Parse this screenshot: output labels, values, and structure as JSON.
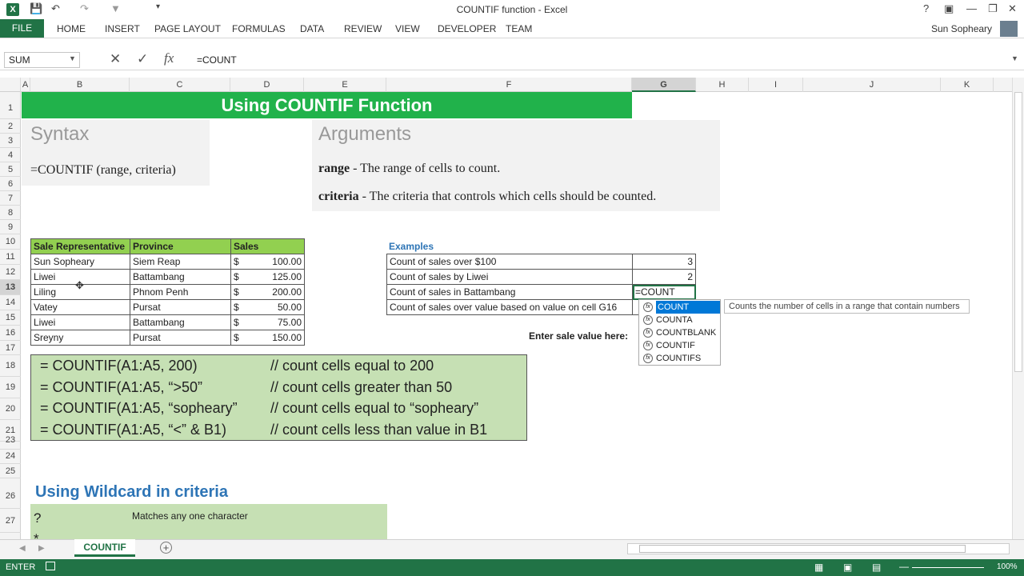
{
  "window": {
    "title": "COUNTIF function - Excel",
    "user": "Sun Sopheary"
  },
  "ribbon": {
    "file": "FILE",
    "tabs": [
      "HOME",
      "INSERT",
      "PAGE LAYOUT",
      "FORMULAS",
      "DATA",
      "REVIEW",
      "VIEW",
      "DEVELOPER",
      "TEAM"
    ]
  },
  "formula": {
    "namebox": "SUM",
    "value": "=COUNT"
  },
  "columns": [
    "A",
    "B",
    "C",
    "D",
    "E",
    "F",
    "G",
    "H",
    "I",
    "J",
    "K"
  ],
  "rows": [
    "1",
    "2",
    "3",
    "4",
    "5",
    "6",
    "7",
    "8",
    "9",
    "10",
    "11",
    "12",
    "13",
    "14",
    "15",
    "16",
    "17",
    "18",
    "19",
    "20",
    "21",
    "22",
    "23",
    "24",
    "25",
    "26",
    "27"
  ],
  "sheet": {
    "title": "Using COUNTIF Function",
    "syntax_heading": "Syntax",
    "syntax": "=COUNTIF (range, criteria)",
    "args_heading": "Arguments",
    "arg1_name": "range",
    "arg1_desc": " - The range of cells to count.",
    "arg2_name": "criteria",
    "arg2_desc": " - The criteria that controls which cells should be counted.",
    "table_headers": [
      "Sale Representative",
      "Province",
      "Sales"
    ],
    "table_rows": [
      [
        "Sun Sopheary",
        "Siem Reap",
        "$",
        "100.00"
      ],
      [
        "Liwei",
        "Battambang",
        "$",
        "125.00"
      ],
      [
        "Liling",
        "Phnom Penh",
        "$",
        "200.00"
      ],
      [
        "Vatey",
        "Pursat",
        "$",
        "50.00"
      ],
      [
        "Liwei",
        "Battambang",
        "$",
        "75.00"
      ],
      [
        "Sreyny",
        "Pursat",
        "$",
        "150.00"
      ]
    ],
    "examples_heading": "Examples",
    "examples": [
      [
        "Count of sales over $100",
        "3"
      ],
      [
        "Count of sales by Liwei",
        "2"
      ],
      [
        "Count of sales in Battambang",
        "=COUNT"
      ],
      [
        "Count of sales over value based on value on cell G16",
        ""
      ]
    ],
    "enter_label": "Enter sale value here:",
    "code_lines": [
      [
        "= COUNTIF(A1:A5, 200)",
        "// count cells equal to 200"
      ],
      [
        "= COUNTIF(A1:A5, “>50”",
        "// count cells greater than 50"
      ],
      [
        "= COUNTIF(A1:A5, “sopheary”",
        "// count cells equal to “sopheary”"
      ],
      [
        "= COUNTIF(A1:A5, “<” & B1)",
        "// count cells less than value in B1"
      ]
    ],
    "wildcard_heading": "Using Wildcard in criteria",
    "wild_symbol": "?",
    "wild_desc": "Matches any one character",
    "wild_symbol2": "*"
  },
  "autocomplete": {
    "items": [
      "COUNT",
      "COUNTA",
      "COUNTBLANK",
      "COUNTIF",
      "COUNTIFS"
    ],
    "tooltip": "Counts the number of cells in a range that contain numbers"
  },
  "sheettab": "COUNTIF",
  "status": {
    "mode": "ENTER",
    "zoom": "100%"
  }
}
